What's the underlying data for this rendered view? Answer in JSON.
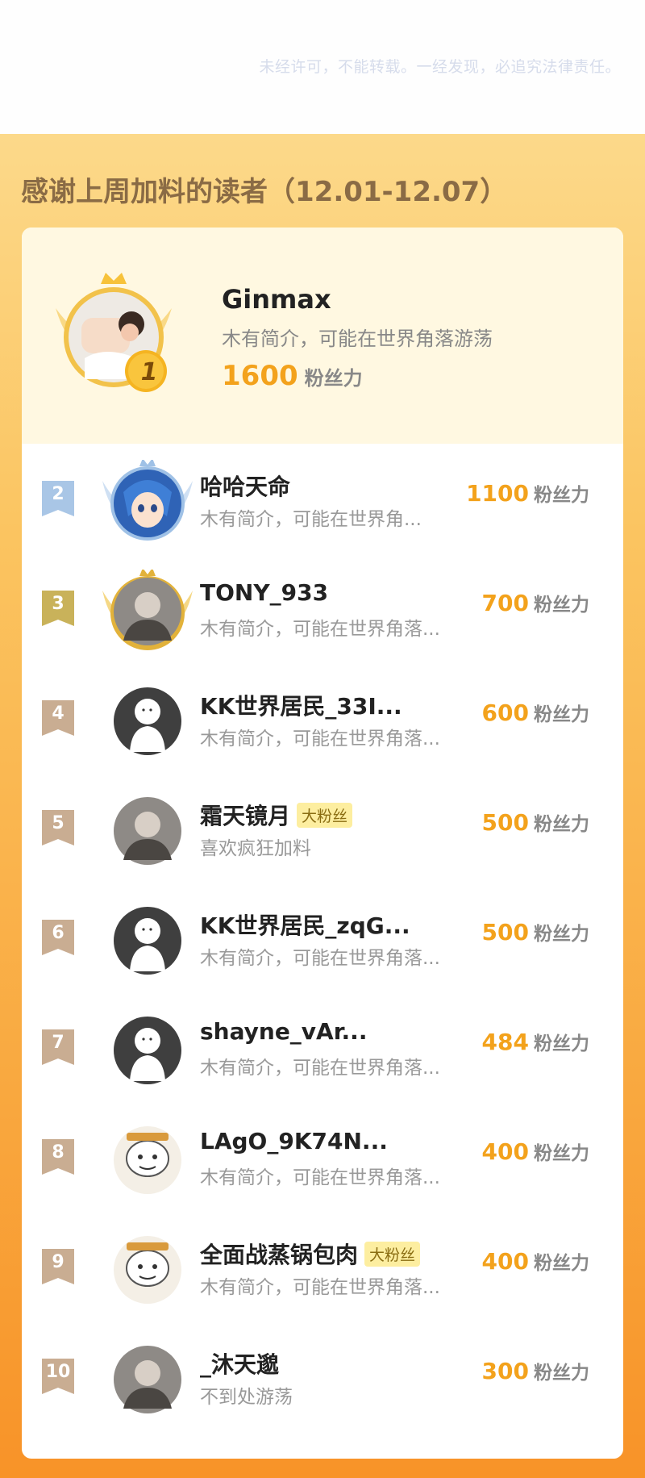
{
  "copyright": "未经许可，不能转载。一经发现，必追究法律责任。",
  "section_title": "感谢上周加料的读者（12.01-12.07）",
  "score_unit": "粉丝力",
  "first": {
    "rank": "1",
    "name": "Ginmax",
    "bio": "木有简介，可能在世界角落游荡",
    "score": "1600"
  },
  "rows": [
    {
      "rank": "2",
      "name": "哈哈天命",
      "badge": "",
      "bio": "木有简介，可能在世界角...",
      "score": "1100",
      "avatar": "anime-avatar",
      "medal": "silver"
    },
    {
      "rank": "3",
      "name": "TONY_933",
      "badge": "",
      "bio": "木有简介，可能在世界角落...",
      "score": "700",
      "avatar": "photo-avatar",
      "medal": "bronze"
    },
    {
      "rank": "4",
      "name": "KK世界居民_33I...",
      "badge": "",
      "bio": "木有简介，可能在世界角落...",
      "score": "600",
      "avatar": "default-avatar",
      "medal": ""
    },
    {
      "rank": "5",
      "name": "霜天镜月",
      "badge": "大粉丝",
      "bio": "喜欢疯狂加料",
      "score": "500",
      "avatar": "photo-avatar",
      "medal": ""
    },
    {
      "rank": "6",
      "name": "KK世界居民_zqG...",
      "badge": "",
      "bio": "木有简介，可能在世界角落...",
      "score": "500",
      "avatar": "default-avatar",
      "medal": ""
    },
    {
      "rank": "7",
      "name": "shayne_vAr...",
      "badge": "",
      "bio": "木有简介，可能在世界角落...",
      "score": "484",
      "avatar": "default-avatar",
      "medal": ""
    },
    {
      "rank": "8",
      "name": "LAgO_9K74N...",
      "badge": "",
      "bio": "木有简介，可能在世界角落...",
      "score": "400",
      "avatar": "cartoon-avatar",
      "medal": ""
    },
    {
      "rank": "9",
      "name": "全面战蒸锅包肉",
      "badge": "大粉丝",
      "bio": "木有简介，可能在世界角落...",
      "score": "400",
      "avatar": "cartoon-avatar",
      "medal": ""
    },
    {
      "rank": "10",
      "name": "_沐天邈",
      "badge": "",
      "bio": "不到处游荡",
      "score": "300",
      "avatar": "photo-avatar",
      "medal": ""
    }
  ],
  "colors": {
    "accent": "#f3a21c",
    "rank_blue": "#a9c6e6",
    "rank_gold": "#c9b25a",
    "rank_tan": "#c9ad92"
  }
}
